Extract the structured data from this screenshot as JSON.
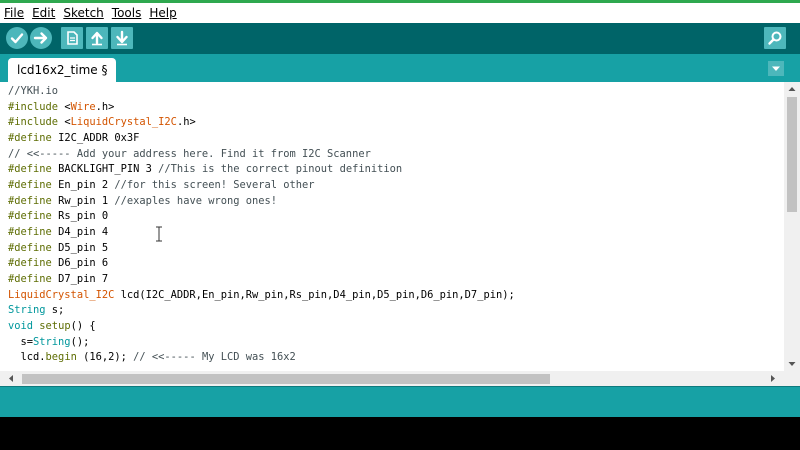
{
  "menu": {
    "items": [
      {
        "label": "File"
      },
      {
        "label": "Edit"
      },
      {
        "label": "Sketch"
      },
      {
        "label": "Tools"
      },
      {
        "label": "Help"
      }
    ]
  },
  "toolbar": {
    "buttons": [
      {
        "name": "verify-button",
        "icon": "check-icon"
      },
      {
        "name": "upload-button",
        "icon": "arrow-right-icon"
      },
      {
        "name": "new-button",
        "icon": "document-icon"
      },
      {
        "name": "open-button",
        "icon": "arrow-up-icon"
      },
      {
        "name": "save-button",
        "icon": "arrow-down-icon"
      }
    ],
    "serial_monitor_icon": "magnifier-icon"
  },
  "tabs": [
    {
      "label": "lcd16x2_time §",
      "active": true
    }
  ],
  "editor": {
    "lines": [
      "//YKH.io",
      "#include <Wire.h>",
      "#include <LiquidCrystal_I2C.h>",
      "#define I2C_ADDR 0x3F",
      "// <<----- Add your address here. Find it from I2C Scanner",
      "#define BACKLIGHT_PIN 3 //This is the correct pinout definition",
      "#define En_pin 2 //for this screen! Several other",
      "#define Rw_pin 1 //exaples have wrong ones!",
      "#define Rs_pin 0",
      "#define D4_pin 4",
      "#define D5_pin 5",
      "#define D6_pin 6",
      "#define D7_pin 7",
      "LiquidCrystal_I2C lcd(I2C_ADDR,En_pin,Rw_pin,Rs_pin,D4_pin,D5_pin,D6_pin,D7_pin);",
      "String s;",
      "void setup() {",
      "  s=String();",
      "  lcd.begin (16,2); // <<----- My LCD was 16x2"
    ]
  },
  "colors": {
    "toolbar_bg": "#006468",
    "tabbar_bg": "#17a1a5",
    "button_bg": "#4db7bb",
    "window_border": "#2fa84f"
  }
}
